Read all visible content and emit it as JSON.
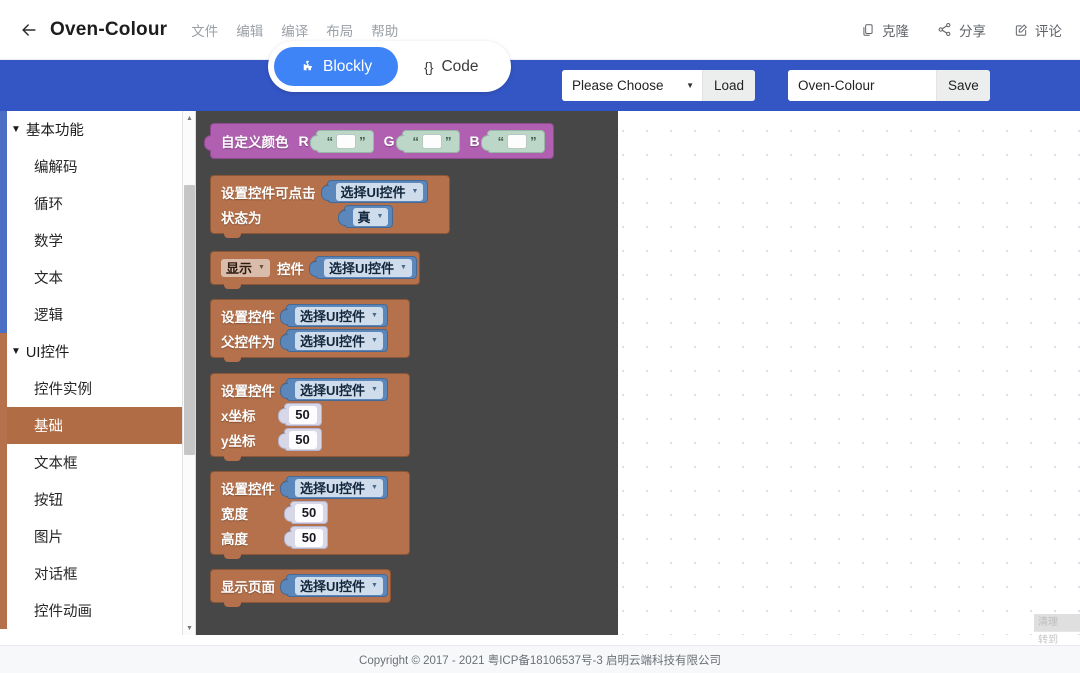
{
  "header": {
    "back_icon": "arrow-left-icon",
    "title": "Oven-Colour",
    "menu": [
      {
        "label": "文件"
      },
      {
        "label": "编辑"
      },
      {
        "label": "编译"
      },
      {
        "label": "布局"
      },
      {
        "label": "帮助"
      }
    ],
    "actions": [
      {
        "icon": "clone-icon",
        "label": "克隆"
      },
      {
        "icon": "share-icon",
        "label": "分享"
      },
      {
        "icon": "comment-icon",
        "label": "评论"
      }
    ]
  },
  "toolbar": {
    "background_color": "#3456c4",
    "tabs": [
      {
        "label": "Blockly",
        "icon": "puzzle-icon",
        "active": true
      },
      {
        "label": "Code",
        "icon": "braces-icon",
        "active": false
      }
    ],
    "project_select": {
      "value": "Please Choose"
    },
    "load_label": "Load",
    "project_name": {
      "value": "Oven-Colour",
      "placeholder": "Oven-Colour"
    },
    "save_label": "Save"
  },
  "sidebar": {
    "groups": [
      {
        "name": "基本功能",
        "color": "#4a6fc4",
        "items": [
          {
            "label": "编解码",
            "selected": false
          },
          {
            "label": "循环",
            "selected": false
          },
          {
            "label": "数学",
            "selected": false
          },
          {
            "label": "文本",
            "selected": false
          },
          {
            "label": "逻辑",
            "selected": false
          }
        ]
      },
      {
        "name": "UI控件",
        "color": "#b5714b",
        "items": [
          {
            "label": "控件实例",
            "selected": false
          },
          {
            "label": "基础",
            "selected": true
          },
          {
            "label": "文本框",
            "selected": false
          },
          {
            "label": "按钮",
            "selected": false
          },
          {
            "label": "图片",
            "selected": false
          },
          {
            "label": "对话框",
            "selected": false
          },
          {
            "label": "控件动画",
            "selected": false
          }
        ]
      }
    ]
  },
  "flyout": {
    "background_color": "#474747",
    "blocks": {
      "custom_colour": {
        "label": "自定义颜色",
        "r_label": "R",
        "g_label": "G",
        "b_label": "B",
        "r_value": "",
        "g_value": "",
        "b_value": "",
        "color": "#b15fb1"
      },
      "set_clickable": {
        "line1": "设置控件可点击",
        "line2": "状态为",
        "widget_value": "选择UI控件",
        "state_value": "真",
        "color": "#b5714b"
      },
      "show_widget": {
        "mode_value": "显示",
        "label": "控件",
        "widget_value": "选择UI控件",
        "color": "#b5714b"
      },
      "set_parent": {
        "line1": "设置控件",
        "line2": "父控件为",
        "widget_value": "选择UI控件",
        "parent_value": "选择UI控件",
        "color": "#b5714b"
      },
      "set_position": {
        "line1": "设置控件",
        "x_label": "x坐标",
        "y_label": "y坐标",
        "widget_value": "选择UI控件",
        "x_value": "50",
        "y_value": "50",
        "color": "#b5714b"
      },
      "set_size": {
        "line1": "设置控件",
        "w_label": "宽度",
        "h_label": "高度",
        "widget_value": "选择UI控件",
        "w_value": "50",
        "h_value": "50",
        "color": "#b5714b"
      },
      "show_page": {
        "label": "显示页面",
        "widget_value": "选择UI控件",
        "color": "#b5714b"
      }
    }
  },
  "context_menu": {
    "items": [
      {
        "label": "清理"
      },
      {
        "label": "转到"
      }
    ]
  },
  "footer": {
    "text": "Copyright © 2017 - 2021 粤ICP备18106537号-3 启明云端科技有限公司"
  }
}
